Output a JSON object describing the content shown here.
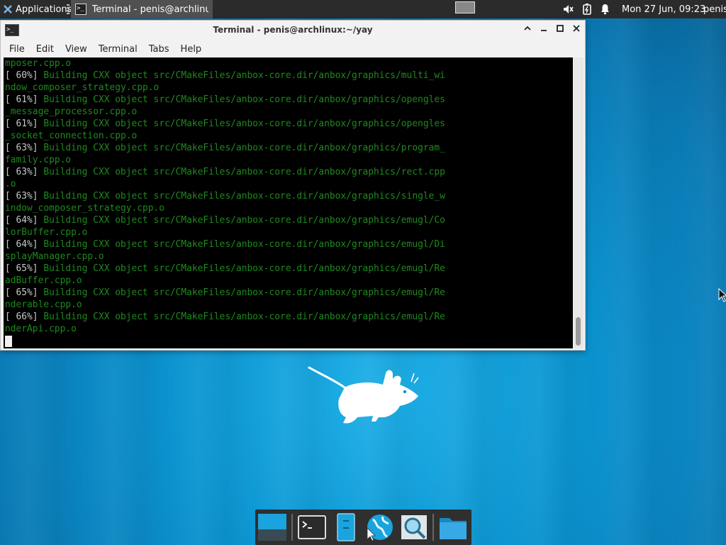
{
  "panel": {
    "applications_label": "Applications",
    "task_label": "Terminal - penis@archlinux:...",
    "clock": "Mon 27 Jun, 09:23",
    "user": "penis"
  },
  "window": {
    "title": "Terminal - penis@archlinux:~/yay",
    "menu": [
      "File",
      "Edit",
      "View",
      "Terminal",
      "Tabs",
      "Help"
    ]
  },
  "terminal": {
    "lines": [
      {
        "pct": "",
        "text": "mposer.cpp.o"
      },
      {
        "pct": "[ 60%]",
        "text": " Building CXX object src/CMakeFiles/anbox-core.dir/anbox/graphics/multi_wi"
      },
      {
        "pct": "",
        "text": "ndow_composer_strategy.cpp.o"
      },
      {
        "pct": "[ 61%]",
        "text": " Building CXX object src/CMakeFiles/anbox-core.dir/anbox/graphics/opengles"
      },
      {
        "pct": "",
        "text": "_message_processor.cpp.o"
      },
      {
        "pct": "[ 61%]",
        "text": " Building CXX object src/CMakeFiles/anbox-core.dir/anbox/graphics/opengles"
      },
      {
        "pct": "",
        "text": "_socket_connection.cpp.o"
      },
      {
        "pct": "[ 63%]",
        "text": " Building CXX object src/CMakeFiles/anbox-core.dir/anbox/graphics/program_"
      },
      {
        "pct": "",
        "text": "family.cpp.o"
      },
      {
        "pct": "[ 63%]",
        "text": " Building CXX object src/CMakeFiles/anbox-core.dir/anbox/graphics/rect.cpp"
      },
      {
        "pct": "",
        "text": ".o"
      },
      {
        "pct": "[ 63%]",
        "text": " Building CXX object src/CMakeFiles/anbox-core.dir/anbox/graphics/single_w"
      },
      {
        "pct": "",
        "text": "indow_composer_strategy.cpp.o"
      },
      {
        "pct": "[ 64%]",
        "text": " Building CXX object src/CMakeFiles/anbox-core.dir/anbox/graphics/emugl/Co"
      },
      {
        "pct": "",
        "text": "lorBuffer.cpp.o"
      },
      {
        "pct": "[ 64%]",
        "text": " Building CXX object src/CMakeFiles/anbox-core.dir/anbox/graphics/emugl/Di"
      },
      {
        "pct": "",
        "text": "splayManager.cpp.o"
      },
      {
        "pct": "[ 65%]",
        "text": " Building CXX object src/CMakeFiles/anbox-core.dir/anbox/graphics/emugl/Re"
      },
      {
        "pct": "",
        "text": "adBuffer.cpp.o"
      },
      {
        "pct": "[ 65%]",
        "text": " Building CXX object src/CMakeFiles/anbox-core.dir/anbox/graphics/emugl/Re"
      },
      {
        "pct": "",
        "text": "nderable.cpp.o"
      },
      {
        "pct": "[ 66%]",
        "text": " Building CXX object src/CMakeFiles/anbox-core.dir/anbox/graphics/emugl/Re"
      },
      {
        "pct": "",
        "text": "nderApi.cpp.o"
      }
    ]
  },
  "dock": {
    "items": [
      "show-desktop-icon",
      "terminal-icon",
      "file-manager-icon",
      "web-browser-icon",
      "app-finder-icon",
      "folder-icon"
    ]
  },
  "colors": {
    "panel_bg": "#2b2b2b",
    "terminal_bg": "#000000",
    "terminal_text": "#1e8a1e",
    "desktop_blue": "#0b93cf"
  }
}
